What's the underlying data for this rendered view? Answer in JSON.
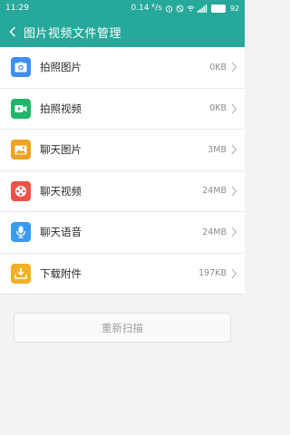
{
  "status_bar": {
    "time": "11:29",
    "speed": "0.14 ᴷ/s",
    "battery": "92"
  },
  "app_bar": {
    "title": "图片视频文件管理"
  },
  "items": [
    {
      "label": "拍照图片",
      "size": "0KB",
      "icon": "camera-icon",
      "color": "#3d8ef5"
    },
    {
      "label": "拍照视频",
      "size": "0KB",
      "icon": "video-camera-icon",
      "color": "#22b46b"
    },
    {
      "label": "聊天图片",
      "size": "3MB",
      "icon": "image-icon",
      "color": "#f0a224"
    },
    {
      "label": "聊天视频",
      "size": "24MB",
      "icon": "play-circle-icon",
      "color": "#ee5247"
    },
    {
      "label": "聊天语音",
      "size": "24MB",
      "icon": "microphone-icon",
      "color": "#3a9af2"
    },
    {
      "label": "下载附件",
      "size": "197KB",
      "icon": "download-icon",
      "color": "#f0b224"
    }
  ],
  "rescan_label": "重新扫描",
  "colors": {
    "accent": "#26a89a"
  }
}
